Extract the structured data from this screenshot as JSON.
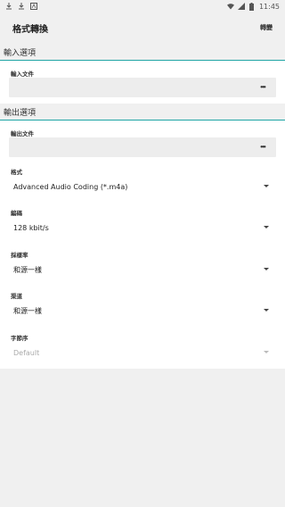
{
  "status_bar": {
    "time": "11:45",
    "left_icons": [
      "download-icon",
      "download-icon",
      "notification-icon"
    ],
    "right_icons": [
      "wifi-icon",
      "signal-icon",
      "battery-icon"
    ]
  },
  "app_bar": {
    "title": "格式轉換",
    "action_label": "轉變"
  },
  "input_section": {
    "header": "輸入選項",
    "file_label": "輸入文件",
    "file_value": "",
    "more_label": "•••"
  },
  "output_section": {
    "header": "輸出選項",
    "file_label": "輸出文件",
    "file_value": "",
    "more_label": "•••",
    "format": {
      "label": "格式",
      "value": "Advanced Audio Coding (*.m4a)"
    },
    "encoding": {
      "label": "編碼",
      "value": "128 kbit/s"
    },
    "sample_rate": {
      "label": "採樣率",
      "value": "和源一樣"
    },
    "channels": {
      "label": "渠道",
      "value": "和源一樣"
    },
    "byte_order": {
      "label": "字節序",
      "value": "Default",
      "disabled": true
    }
  },
  "colors": {
    "accent": "#1fa5a5",
    "background": "#f0f0f0",
    "panel": "#ffffff",
    "field": "#ededed"
  }
}
